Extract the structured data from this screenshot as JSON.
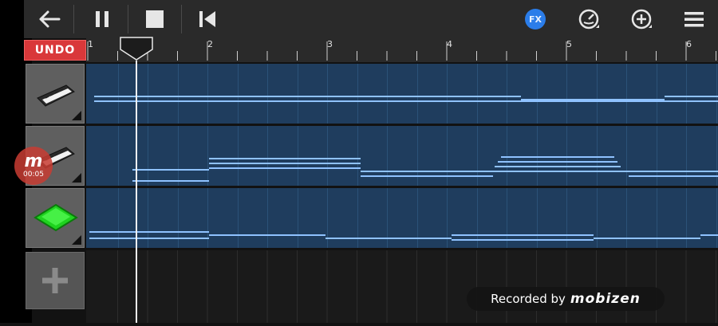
{
  "toolbar": {
    "back_icon": "back-arrow-icon",
    "pause_icon": "pause-icon",
    "stop_icon": "stop-icon",
    "rewind_icon": "skip-to-start-icon",
    "fx_label": "FX",
    "metronome_icon": "metronome-icon",
    "add_icon": "add-circle-icon",
    "menu_icon": "hamburger-menu-icon"
  },
  "undo_label": "UNDO",
  "ruler": {
    "bars": [
      "1",
      "2",
      "3",
      "4",
      "5",
      "6"
    ]
  },
  "tracks": [
    {
      "name": "keyboard-track-1",
      "icon": "keyboard-synth-icon"
    },
    {
      "name": "keyboard-track-2",
      "icon": "keyboard-synth-icon"
    },
    {
      "name": "drum-track",
      "icon": "green-drum-pad-icon"
    }
  ],
  "recorder_badge": {
    "logo": "m",
    "time": "00:05"
  },
  "watermark": {
    "prefix": "Recorded by",
    "brand": "mobizen"
  },
  "colors": {
    "lane": "#1f3d5e",
    "note": "#8fc2ff",
    "undo": "#d9383a",
    "fx": "#2b7de9"
  }
}
